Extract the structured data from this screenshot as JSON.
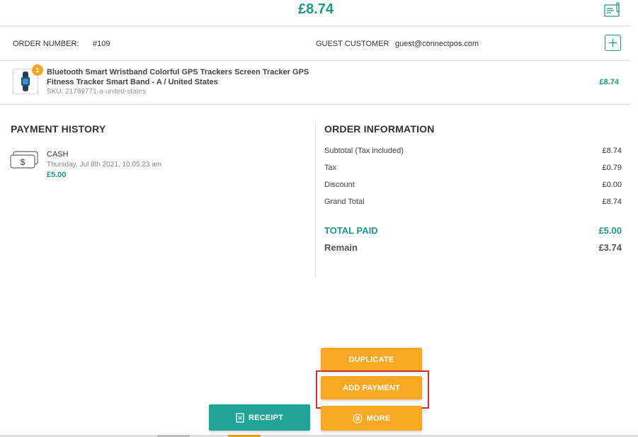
{
  "header": {
    "total": "£8.74"
  },
  "order": {
    "number_label": "ORDER NUMBER:",
    "number_value": "#109",
    "customer_label": "GUEST CUSTOMER",
    "customer_email": "guest@connectpos.com"
  },
  "item": {
    "qty": "1",
    "name": "Bluetooth Smart Wristband Colorful GPS Trackers Screen Tracker GPS Fitness Tracker Smart Band - A / United States",
    "sku": "SKU: 21789771-a-united-states",
    "price": "£8.74"
  },
  "payment_history": {
    "title": "PAYMENT HISTORY",
    "method": "CASH",
    "date": "Thursday, Jul 8th 2021, 10:05:23 am",
    "amount": "£5.00"
  },
  "order_information": {
    "title": "ORDER INFORMATION",
    "rows": [
      {
        "label": "Subtotal (Tax included)",
        "value": "£8.74"
      },
      {
        "label": "Tax",
        "value": "£0.79"
      },
      {
        "label": "Discount",
        "value": "£0.00"
      },
      {
        "label": "Grand Total",
        "value": "£8.74"
      }
    ],
    "total_paid_label": "TOTAL PAID",
    "total_paid_value": "£5.00",
    "remain_label": "Remain",
    "remain_value": "£3.74"
  },
  "actions": {
    "duplicate": "DUPLICATE",
    "add_payment": "ADD PAYMENT",
    "receipt": "RECEIPT",
    "more": "MORE"
  },
  "colors": {
    "accent": "#1a9a8a",
    "orange": "#f9a825",
    "highlight": "#d32f2f"
  }
}
